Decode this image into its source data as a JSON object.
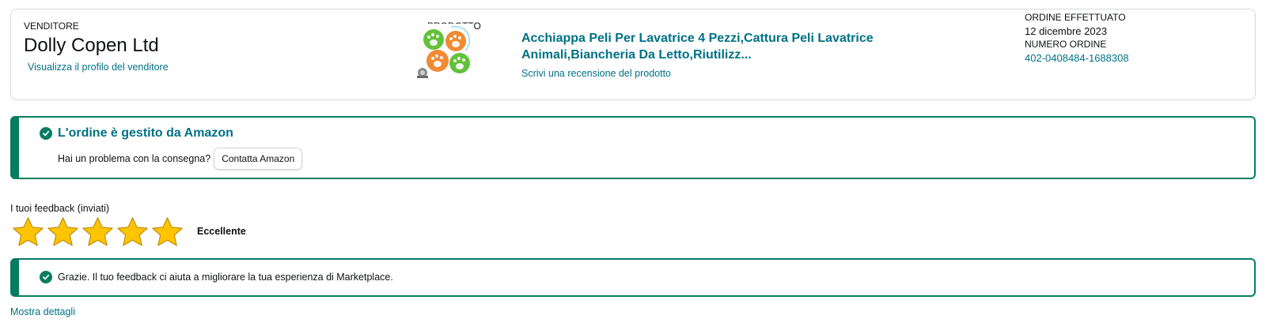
{
  "seller": {
    "caption": "VENDITORE",
    "name": "Dolly Copen Ltd",
    "profile_link": "Visualizza il profilo del venditore"
  },
  "product": {
    "caption": "PRODOTTO",
    "title": "Acchiappa Peli Per Lavatrice 4 Pezzi,Cattura Peli Lavatrice Animali,Biancheria Da Letto,Riutilizz...",
    "review_link": "Scrivi una recensione del prodotto",
    "thumbnail_icon": "paw-lint-catcher-balls-image"
  },
  "order": {
    "placed_caption": "ORDINE EFFETTUATO",
    "placed_date": "12 dicembre 2023",
    "number_caption": "NUMERO ORDINE",
    "number": "402-0408484-1688308"
  },
  "fulfillment_alert": {
    "icon": "check-circle-icon",
    "title": "L'ordine è gestito da Amazon",
    "question": "Hai un problema con la consegna?",
    "button_label": "Contatta Amazon"
  },
  "feedback": {
    "label": "I tuoi feedback (inviati)",
    "rating": 5,
    "max_rating": 5,
    "rating_text": "Eccellente",
    "star_icon": "star-icon"
  },
  "thanks_alert": {
    "icon": "check-circle-icon",
    "text": "Grazie. Il tuo feedback ci aiuta a migliorare la tua esperienza di Marketplace."
  },
  "show_details_link": "Mostra dettagli",
  "colors": {
    "link": "#007185",
    "alert_border": "#067d62",
    "star": "#ffc400",
    "card_border": "#d5d9d9"
  }
}
